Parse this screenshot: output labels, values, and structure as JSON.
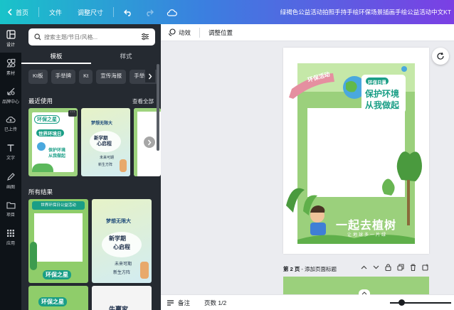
{
  "topbar": {
    "home": "首页",
    "file": "文件",
    "resize": "调整尺寸",
    "doc_title": "绿褐色公益活动拍照手持手绘环保场景插画手绘公益活动中文KT"
  },
  "rail": [
    {
      "label": "设计",
      "icon": "layout-icon"
    },
    {
      "label": "素材",
      "icon": "shapes-icon"
    },
    {
      "label": "品牌中心",
      "icon": "brand-icon"
    },
    {
      "label": "已上传",
      "icon": "upload-icon"
    },
    {
      "label": "文字",
      "icon": "text-icon"
    },
    {
      "label": "画图",
      "icon": "draw-icon"
    },
    {
      "label": "项目",
      "icon": "folder-icon"
    },
    {
      "label": "应用",
      "icon": "apps-icon"
    }
  ],
  "panel": {
    "search_placeholder": "搜索主题/节日/风格...",
    "tabs": [
      "模板",
      "样式"
    ],
    "chips": [
      "Kt板",
      "手举牌",
      "Kt",
      "宣传海报",
      "手举拍照"
    ],
    "recent_title": "最近使用",
    "see_all": "查看全部",
    "all_results_title": "所有结果"
  },
  "thumbs": {
    "recent1": {
      "title": "环保之星",
      "sub": "世界环境日",
      "line3": "保护环境",
      "line4": "从我做起"
    },
    "recent2": {
      "title": "梦想无限大",
      "line2": "新学期",
      "line3": "心启程",
      "line4": "未来可期",
      "line5": "新生方阵"
    },
    "result1": {
      "banner": "世界环保日公益活动",
      "title": "环保之星"
    },
    "result2": {
      "title": "梦想无限大",
      "line2": "新学期",
      "line3": "心启程",
      "line4": "未来可期",
      "line5": "新生方阵"
    },
    "result3": {
      "title": "环保之星"
    },
    "result4": {
      "title": "牛赢家"
    }
  },
  "toolbar": {
    "animate": "动效",
    "position": "调整位置"
  },
  "design": {
    "ribbon": "环保活动",
    "badge": "环保日暑",
    "headline1": "保护环境",
    "headline2": "从我做起",
    "slogan": "一起去植树",
    "sub_slogan": "让地球多一片绿"
  },
  "page2": {
    "label_prefix": "第 2 页",
    "label_suffix": " - 添加页面标题"
  },
  "bottombar": {
    "notes": "备注",
    "pages": "页数 1/2"
  },
  "colors": {
    "accent_start": "#19c3c9",
    "accent_end": "#7b3fe4",
    "panel_bg": "#252a31",
    "rail_bg": "#0e1318",
    "green": "#8fcd6a",
    "teal": "#1a9e86"
  }
}
